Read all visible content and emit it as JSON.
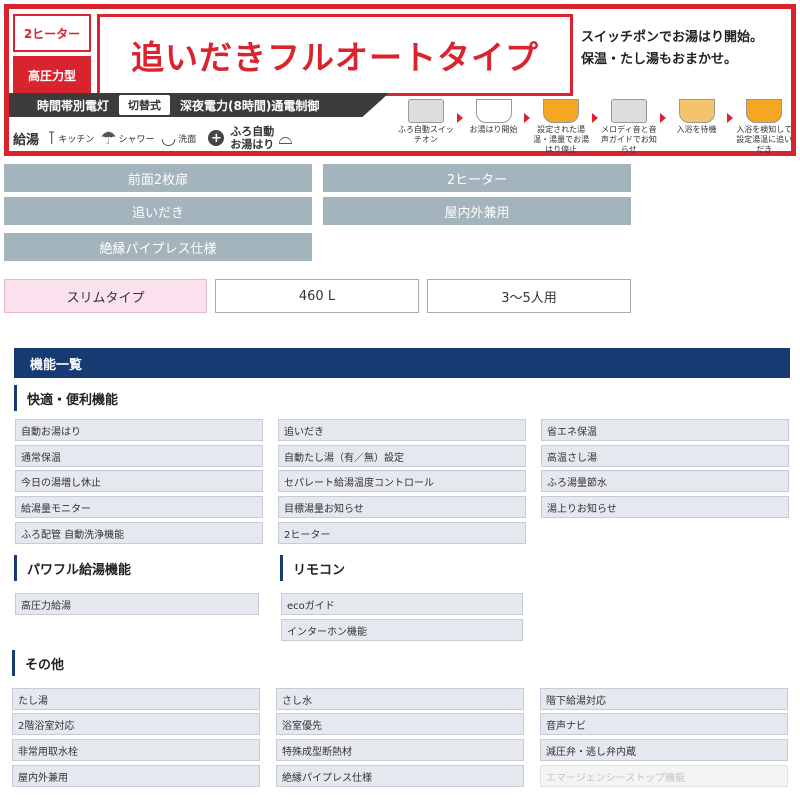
{
  "banner": {
    "tag_top": "2ヒーター",
    "tag_bottom": "高圧力型",
    "title": "追いだきフルオートタイプ",
    "tagline_1": "スイッチポンでお湯はり開始。",
    "tagline_2": "保温・たし湯もおまかせ。",
    "strip_left": "時間帯別電灯",
    "strip_switch": "切替式",
    "strip_right": "深夜電力(8時間)通電制御",
    "supply_label": "給湯",
    "supply_kitchen": "キッチン",
    "supply_shower": "シャワー",
    "supply_wash": "洗面",
    "supply_auto_1": "ふろ自動",
    "supply_auto_2": "お湯はり",
    "steps": [
      "ふろ自動スイッチオン",
      "お湯はり開始",
      "設定された湯温・湯量でお湯はり停止",
      "メロディ音と音声ガイドでお知らせ",
      "入浴を待機",
      "入浴を検知して設定湯温に追いだき"
    ]
  },
  "specs": {
    "tiles": [
      "前面2枚扉",
      "2ヒーター",
      "追いだき",
      "屋内外兼用",
      "絶縁パイプレス仕様"
    ],
    "type": "スリムタイプ",
    "capacity": "460 L",
    "persons": "3〜5人用"
  },
  "features": {
    "header": "機能一覧",
    "comfort": {
      "title": "快適・便利機能",
      "items": [
        "自動お湯はり",
        "追いだき",
        "省エネ保温",
        "通常保温",
        "自動たし湯（有／無）設定",
        "高温さし湯",
        "今日の湯増し休止",
        "セパレート給湯温度コントロール",
        "ふろ湯量節水",
        "給湯量モニター",
        "目標湯量お知らせ",
        "湯上りお知らせ",
        "ふろ配管 自動洗浄機能",
        "2ヒーター"
      ]
    },
    "power": {
      "title": "パワフル給湯機能",
      "items": [
        "高圧力給湯"
      ]
    },
    "remote": {
      "title": "リモコン",
      "items": [
        "ecoガイド",
        "インターホン機能"
      ]
    },
    "other": {
      "title": "その他",
      "items": [
        "たし湯",
        "さし水",
        "階下給湯対応",
        "2階浴室対応",
        "浴室優先",
        "音声ナビ",
        "非常用取水栓",
        "特殊成型断熱材",
        "減圧弁・逃し弁内蔵",
        "屋内外兼用",
        "絶縁パイプレス仕様",
        "エマージェンシーストップ機能"
      ],
      "disabled_index": 11
    }
  }
}
